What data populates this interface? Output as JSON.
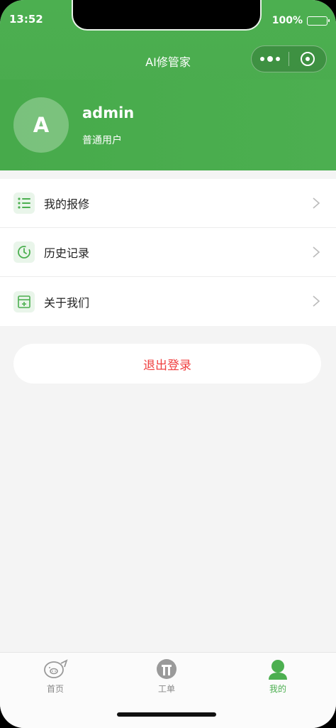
{
  "status_bar": {
    "time": "13:52",
    "battery": "100%"
  },
  "nav": {
    "title": "AI修管家"
  },
  "colors": {
    "accent": "#4caf50",
    "logout": "#f04040",
    "tab_inactive": "#888888"
  },
  "profile": {
    "avatar_letter": "A",
    "username": "admin",
    "role": "普通用户"
  },
  "menu": {
    "items": [
      {
        "label": "我的报修",
        "icon": "list-icon"
      },
      {
        "label": "历史记录",
        "icon": "clock-icon"
      },
      {
        "label": "关于我们",
        "icon": "info-card-icon"
      }
    ]
  },
  "logout": {
    "label": "退出登录"
  },
  "tabbar": {
    "items": [
      {
        "label": "首页",
        "icon": "home-mascot-icon",
        "active": false
      },
      {
        "label": "工单",
        "icon": "workorder-icon",
        "active": false
      },
      {
        "label": "我的",
        "icon": "user-icon",
        "active": true
      }
    ]
  }
}
